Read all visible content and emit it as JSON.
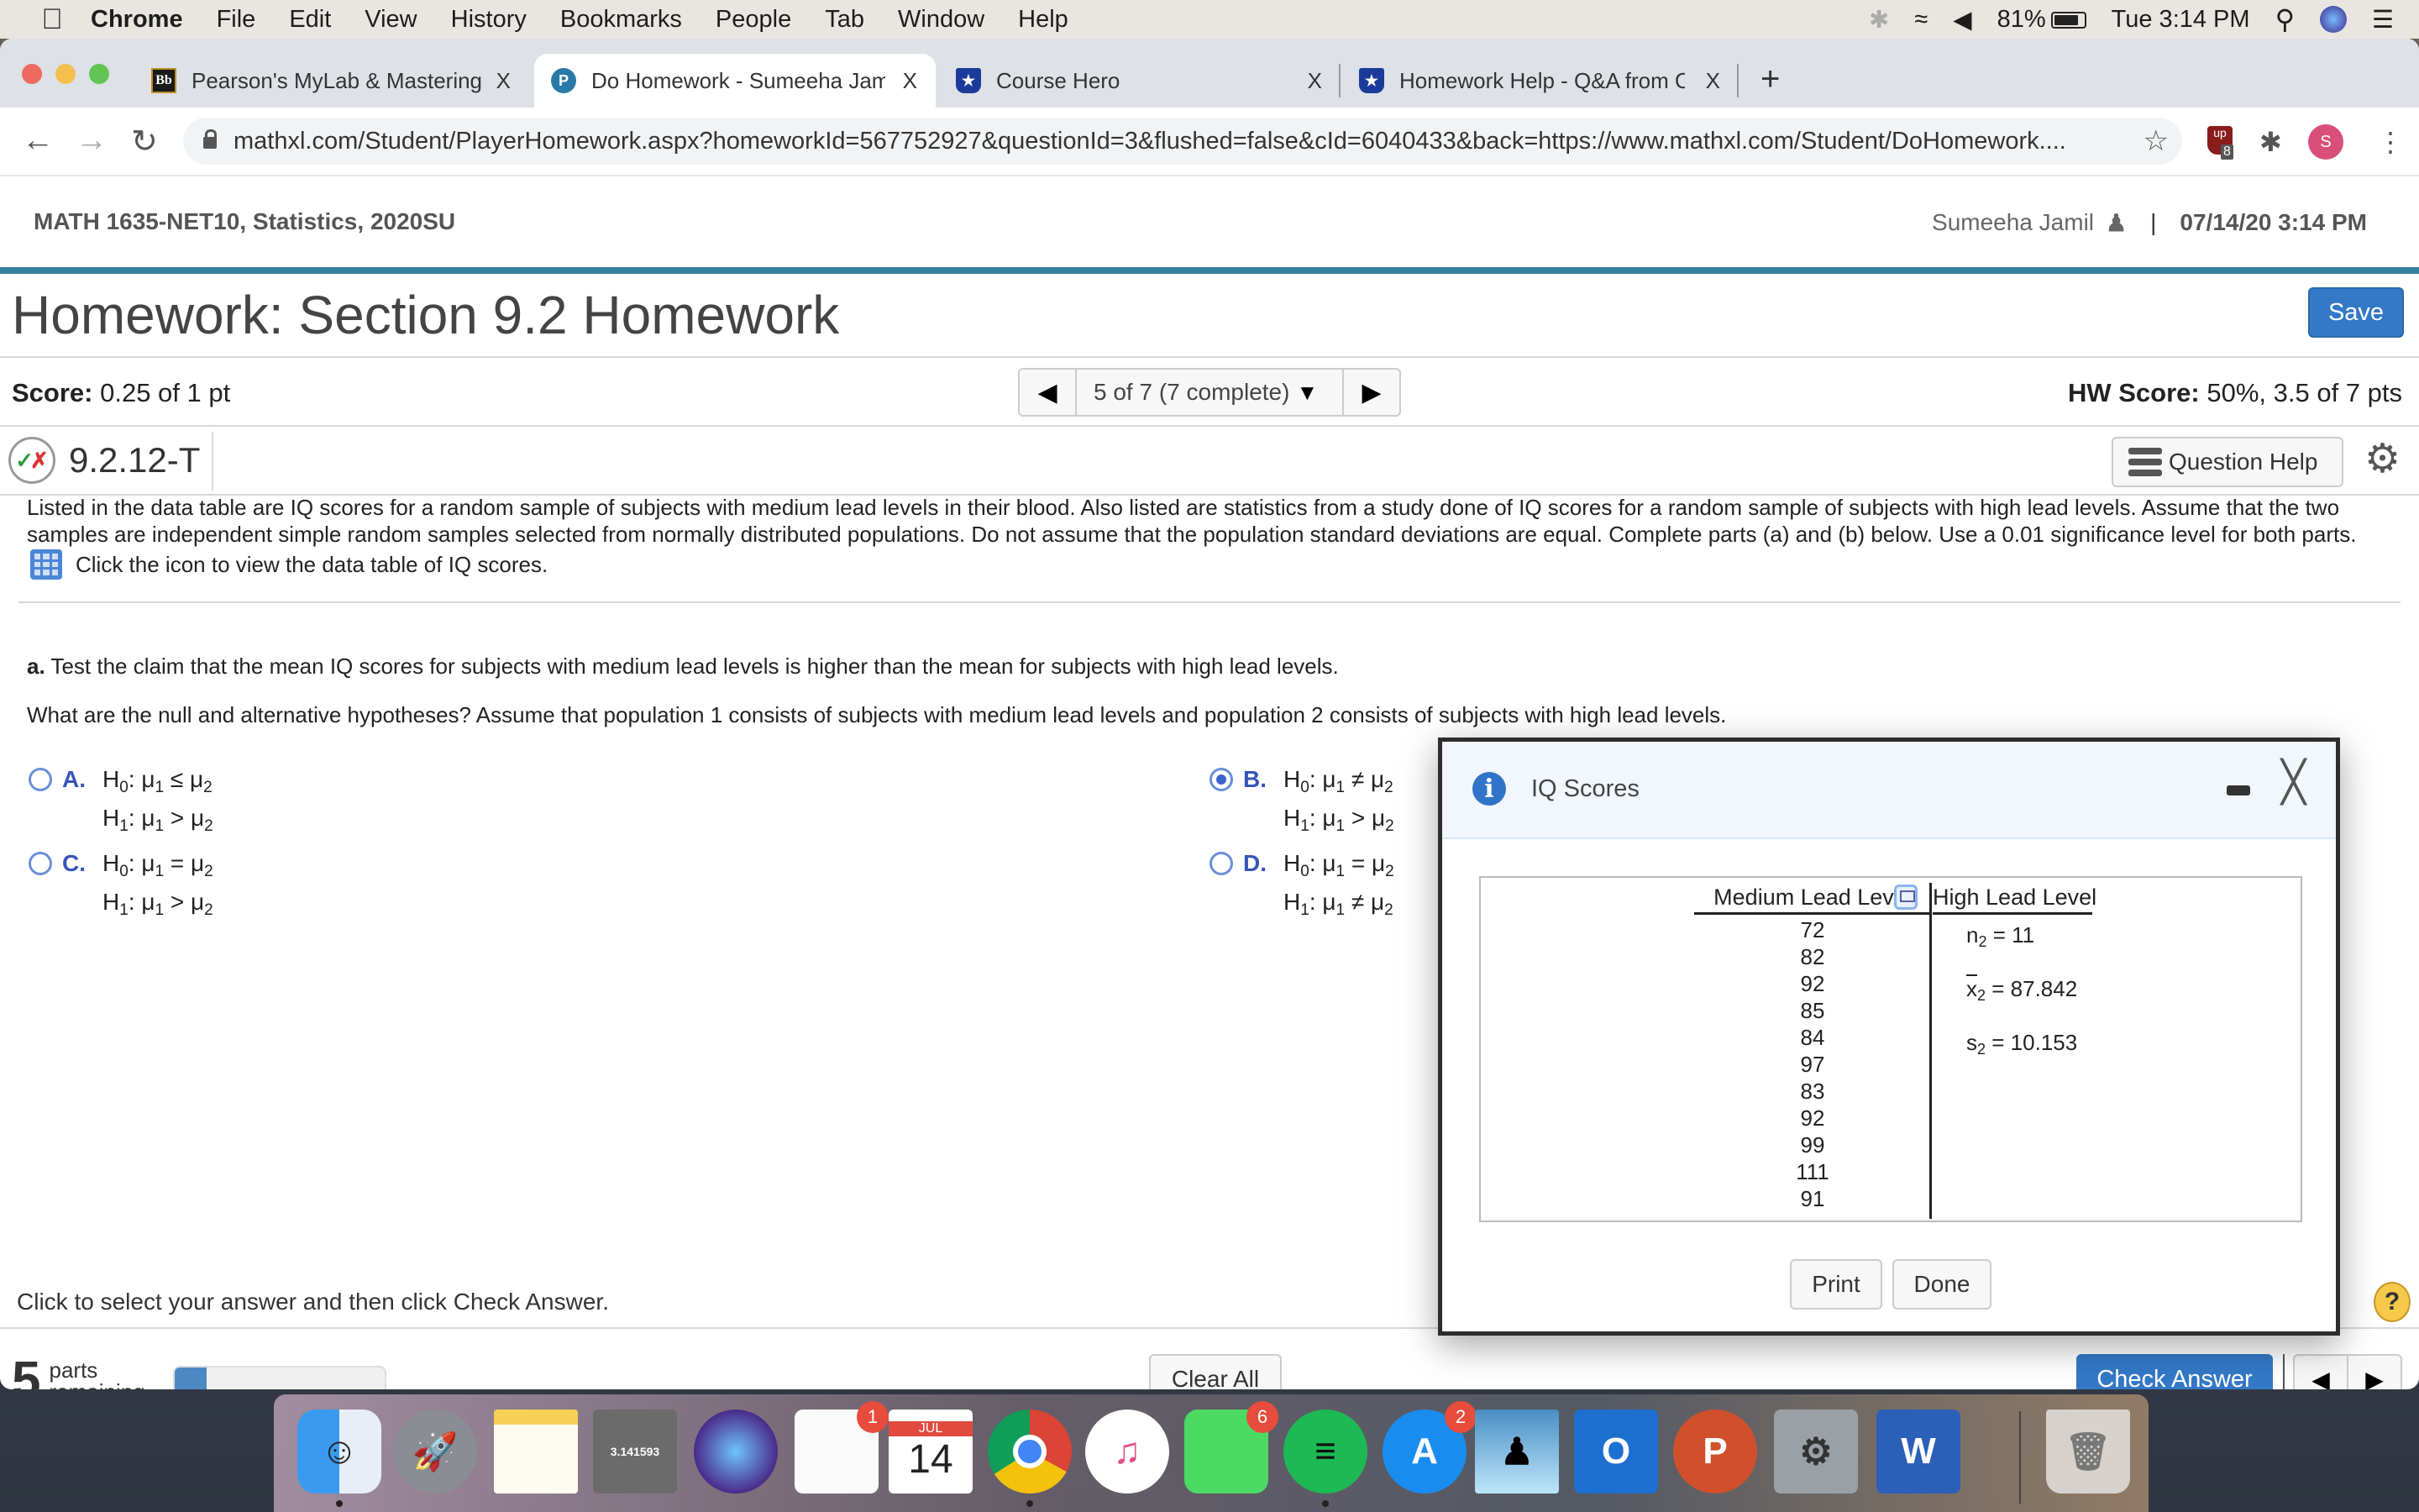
{
  "menubar": {
    "app": "Chrome",
    "items": [
      "File",
      "Edit",
      "View",
      "History",
      "Bookmarks",
      "People",
      "Tab",
      "Window",
      "Help"
    ],
    "battery": "81%",
    "clock": "Tue 3:14 PM"
  },
  "browser": {
    "tabs": [
      {
        "title": "Pearson's MyLab & Mastering -",
        "favicon": "Bb",
        "active": false
      },
      {
        "title": "Do Homework - Sumeeha Jami",
        "favicon": "P",
        "active": true
      },
      {
        "title": "Course Hero",
        "favicon": "star-shield",
        "active": false
      },
      {
        "title": "Homework Help - Q&A from Or",
        "favicon": "star-shield",
        "active": false
      }
    ],
    "close_glyph": "X",
    "new_tab_glyph": "+",
    "url": "mathxl.com/Student/PlayerHomework.aspx?homeworkId=567752927&questionId=3&flushed=false&cId=6040433&back=https://www.mathxl.com/Student/DoHomework....",
    "extension_badge": "8",
    "profile_initial": "S"
  },
  "course": {
    "name": "MATH 1635-NET10, Statistics, 2020SU",
    "user": "Sumeeha Jamil",
    "separator": "|",
    "datetime": "07/14/20 3:14 PM"
  },
  "homework": {
    "title": "Homework: Section 9.2 Homework",
    "save_label": "Save",
    "score_label": "Score:",
    "score_value": " 0.25 of 1 pt",
    "nav_label": "5 of 7 (7 complete)",
    "hw_score_label": "HW Score:",
    "hw_score_value": " 50%, 3.5 of 7 pts",
    "question_id": "9.2.12-T",
    "question_help_label": "Question Help"
  },
  "question": {
    "intro": "Listed in the data table are IQ scores for a random sample of subjects with medium lead levels in their blood. Also listed are statistics from a study done of IQ scores for a random sample of subjects with high lead levels. Assume that the two samples are independent simple random samples selected from normally distributed populations. Do not assume that the population standard deviations are equal. Complete parts (a) and (b) below. Use a 0.01 significance level for both parts.",
    "data_link": "Click the icon to view the data table of IQ scores.",
    "part_a_label": "a.",
    "part_a_text": " Test the claim that the mean IQ scores for subjects with  medium lead levels is higher than the mean for subjects with high lead levels.",
    "hypotheses_prompt": "What are the null and alternative hypotheses? Assume that population 1 consists of subjects with medium lead levels and population 2 consists of subjects with high lead levels.",
    "options": [
      {
        "letter": "A.",
        "h0_op": "≤",
        "h1_op": ">",
        "selected": false
      },
      {
        "letter": "B.",
        "h0_op": "≠",
        "h1_op": ">",
        "selected": true
      },
      {
        "letter": "C.",
        "h0_op": "=",
        "h1_op": ">",
        "selected": false
      },
      {
        "letter": "D.",
        "h0_op": "=",
        "h1_op": "≠",
        "selected": false
      }
    ],
    "select_hint": "Click to select your answer and then click Check Answer."
  },
  "footer": {
    "parts_remaining": "5",
    "parts_label1": "parts",
    "parts_label2": "remaining",
    "progress_fraction": 0.15,
    "clear_all_label": "Clear All",
    "check_answer_label": "Check Answer"
  },
  "modal": {
    "title": "IQ Scores",
    "medium_header": "Medium Lead Level",
    "high_header": "High Lead Level",
    "medium_values": [
      "72",
      "82",
      "92",
      "85",
      "84",
      "97",
      "83",
      "92",
      "99",
      "111",
      "91"
    ],
    "high_stats": {
      "n_label": "n",
      "n_sub": "2",
      "n_value": " = 11",
      "x_label": "x",
      "x_sub": "2",
      "x_value": " = 87.842",
      "s_label": "s",
      "s_sub": "2",
      "s_value": " = 10.153"
    },
    "print_label": "Print",
    "done_label": "Done"
  },
  "dock": {
    "apps": [
      {
        "name": "Finder",
        "badge": ""
      },
      {
        "name": "Launchpad",
        "badge": ""
      },
      {
        "name": "Notes",
        "badge": ""
      },
      {
        "name": "Calculator",
        "badge": ""
      },
      {
        "name": "Siri",
        "badge": ""
      },
      {
        "name": "Reminders",
        "badge": "1"
      },
      {
        "name": "Calendar",
        "badge": "",
        "month": "JUL",
        "day": "14"
      },
      {
        "name": "Chrome",
        "badge": ""
      },
      {
        "name": "Music",
        "badge": ""
      },
      {
        "name": "FaceTime",
        "badge": "6"
      },
      {
        "name": "Spotify",
        "badge": ""
      },
      {
        "name": "App Store",
        "badge": "2"
      },
      {
        "name": "Kindle",
        "badge": ""
      },
      {
        "name": "Outlook",
        "badge": "",
        "letter": "O"
      },
      {
        "name": "PowerPoint",
        "badge": "",
        "letter": "P"
      },
      {
        "name": "System Preferences",
        "badge": ""
      },
      {
        "name": "Word",
        "badge": "",
        "letter": "W"
      },
      {
        "name": "Trash",
        "badge": ""
      }
    ]
  },
  "colors": {
    "accent_line": "#327ea0",
    "primary_button": "#3379c7",
    "option_letter": "#3654b8",
    "info_icon": "#2f74c8"
  }
}
